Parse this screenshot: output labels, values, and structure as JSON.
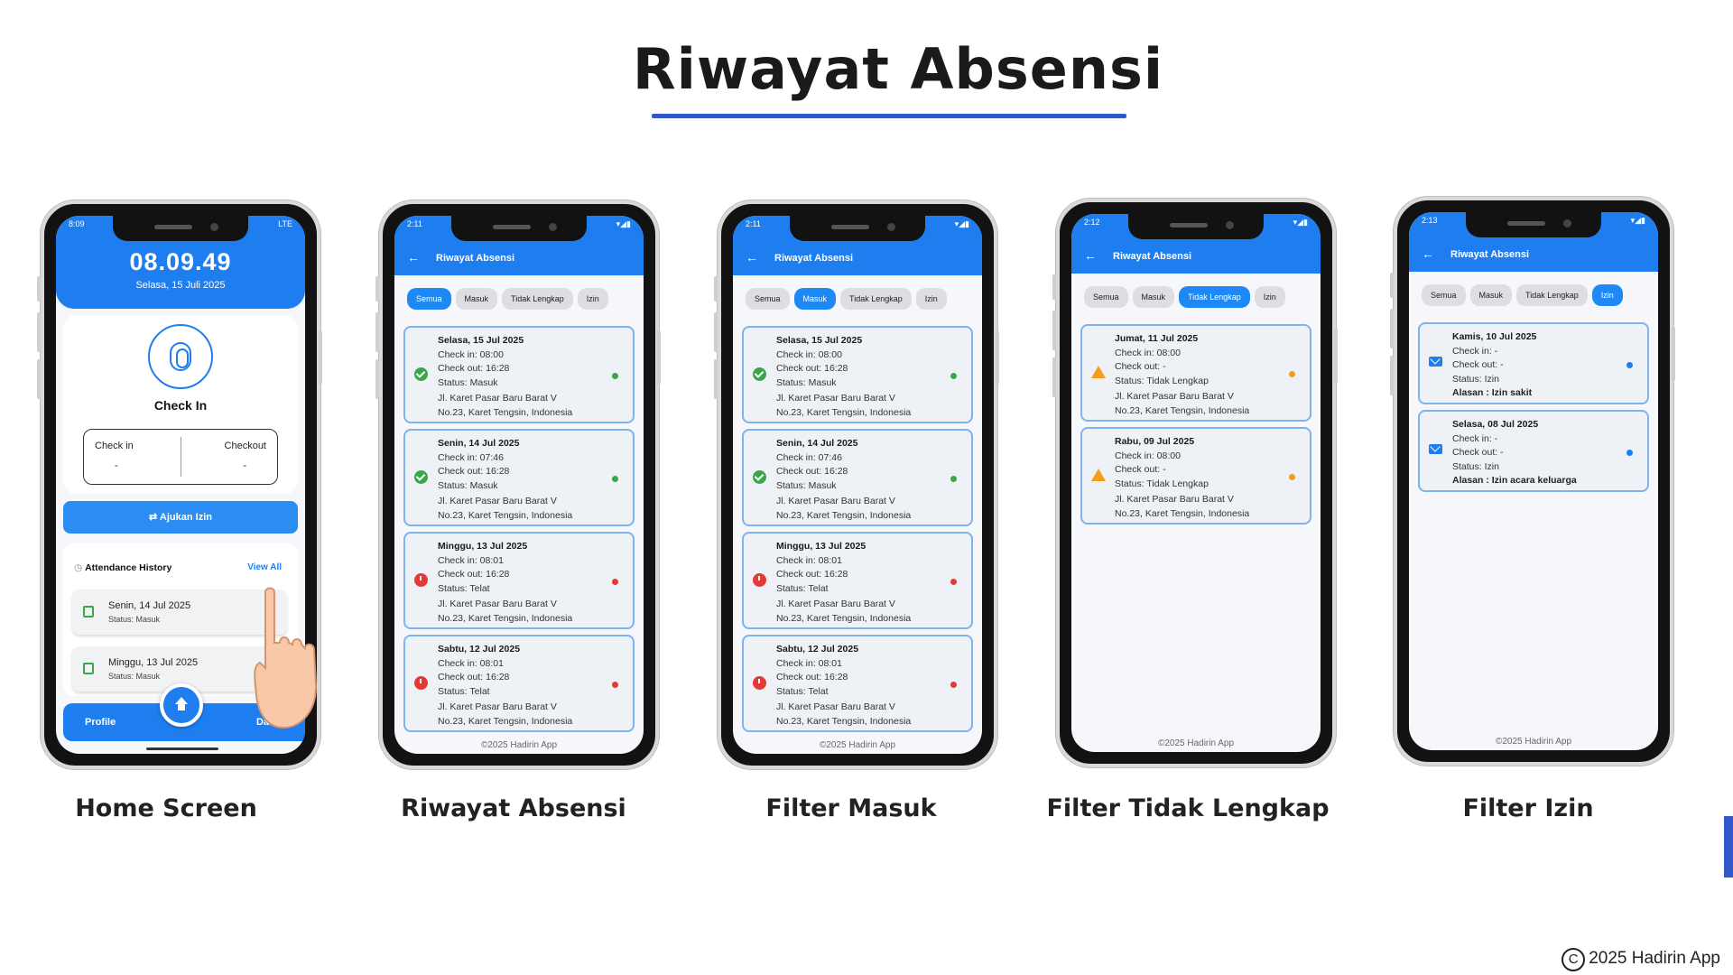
{
  "page_title": "Riwayat Absensi",
  "copyright": "2025 Hadirin App",
  "home": {
    "status_time": "8:09",
    "status_net": "LTE",
    "clock": "08.09.49",
    "date": "Selasa, 15 Juli 2025",
    "check_in_label": "Check In",
    "checkin_col": "Check in",
    "checkin_val": "-",
    "checkout_col": "Checkout",
    "checkout_val": "-",
    "izin_button": "Ajukan Izin",
    "history_title": "Attendance History",
    "view_all": "View All",
    "history": [
      {
        "date": "Senin, 14 Jul 2025",
        "status": "Status: Masuk"
      },
      {
        "date": "Minggu, 13 Jul 2025",
        "status": "Status: Masuk"
      }
    ],
    "nav_profile": "Profile",
    "nav_dashboard": "Dasboar",
    "caption": "Home Screen"
  },
  "screens": [
    {
      "caption": "Riwayat Absensi",
      "time": "2:11",
      "appbar_title": "Riwayat Absensi",
      "filters": [
        "Semua",
        "Masuk",
        "Tidak Lengkap",
        "Izin"
      ],
      "active_filter": 0,
      "footer": "©2025 Hadirin App",
      "cards": [
        {
          "date": "Selasa, 15 Jul 2025",
          "in": "Check in: 08:00",
          "out": "Check out: 16:28",
          "status": "Status: Masuk",
          "addr1": "Jl. Karet Pasar Baru Barat V",
          "addr2": "No.23, Karet Tengsin, Indonesia",
          "kind": "ok"
        },
        {
          "date": "Senin, 14 Jul 2025",
          "in": "Check in: 07:46",
          "out": "Check out: 16:28",
          "status": "Status: Masuk",
          "addr1": "Jl. Karet Pasar Baru Barat V",
          "addr2": "No.23, Karet Tengsin, Indonesia",
          "kind": "ok"
        },
        {
          "date": "Minggu, 13 Jul 2025",
          "in": "Check in: 08:01",
          "out": "Check out: 16:28",
          "status": "Status: Telat",
          "addr1": "Jl. Karet Pasar Baru Barat V",
          "addr2": "No.23, Karet Tengsin, Indonesia",
          "kind": "late"
        },
        {
          "date": "Sabtu, 12 Jul 2025",
          "in": "Check in: 08:01",
          "out": "Check out: 16:28",
          "status": "Status: Telat",
          "addr1": "Jl. Karet Pasar Baru Barat V",
          "addr2": "No.23, Karet Tengsin, Indonesia",
          "kind": "late"
        }
      ]
    },
    {
      "caption": "Filter Masuk",
      "time": "2:11",
      "appbar_title": "Riwayat Absensi",
      "filters": [
        "Semua",
        "Masuk",
        "Tidak Lengkap",
        "Izin"
      ],
      "active_filter": 1,
      "footer": "©2025 Hadirin App",
      "cards": [
        {
          "date": "Selasa, 15 Jul 2025",
          "in": "Check in: 08:00",
          "out": "Check out: 16:28",
          "status": "Status: Masuk",
          "addr1": "Jl. Karet Pasar Baru Barat V",
          "addr2": "No.23, Karet Tengsin, Indonesia",
          "kind": "ok"
        },
        {
          "date": "Senin, 14 Jul 2025",
          "in": "Check in: 07:46",
          "out": "Check out: 16:28",
          "status": "Status: Masuk",
          "addr1": "Jl. Karet Pasar Baru Barat V",
          "addr2": "No.23, Karet Tengsin, Indonesia",
          "kind": "ok"
        },
        {
          "date": "Minggu, 13 Jul 2025",
          "in": "Check in: 08:01",
          "out": "Check out: 16:28",
          "status": "Status: Telat",
          "addr1": "Jl. Karet Pasar Baru Barat V",
          "addr2": "No.23, Karet Tengsin, Indonesia",
          "kind": "late"
        },
        {
          "date": "Sabtu, 12 Jul 2025",
          "in": "Check in: 08:01",
          "out": "Check out: 16:28",
          "status": "Status: Telat",
          "addr1": "Jl. Karet Pasar Baru Barat V",
          "addr2": "No.23, Karet Tengsin, Indonesia",
          "kind": "late"
        }
      ]
    },
    {
      "caption": "Filter Tidak Lengkap",
      "time": "2:12",
      "appbar_title": "Riwayat Absensi",
      "filters": [
        "Semua",
        "Masuk",
        "Tidak Lengkap",
        "Izin"
      ],
      "active_filter": 2,
      "footer": "©2025 Hadirin App",
      "cards": [
        {
          "date": "Jumat, 11 Jul 2025",
          "in": "Check in: 08:00",
          "out": "Check out: -",
          "status": "Status: Tidak Lengkap",
          "addr1": "Jl. Karet Pasar Baru Barat V",
          "addr2": "No.23, Karet Tengsin, Indonesia",
          "kind": "warn"
        },
        {
          "date": "Rabu, 09 Jul 2025",
          "in": "Check in: 08:00",
          "out": "Check out: -",
          "status": "Status: Tidak Lengkap",
          "addr1": "Jl. Karet Pasar Baru Barat V",
          "addr2": "No.23, Karet Tengsin, Indonesia",
          "kind": "warn"
        }
      ]
    },
    {
      "caption": "Filter Izin",
      "time": "2:13",
      "appbar_title": "Riwayat Absensi",
      "filters": [
        "Semua",
        "Masuk",
        "Tidak Lengkap",
        "Izin"
      ],
      "active_filter": 3,
      "footer": "©2025 Hadirin App",
      "cards": [
        {
          "date": "Kamis, 10 Jul 2025",
          "in": "Check in: -",
          "out": "Check out: -",
          "status": "Status: Izin",
          "reason": "Alasan : Izin sakit",
          "kind": "mail"
        },
        {
          "date": "Selasa, 08 Jul 2025",
          "in": "Check in: -",
          "out": "Check out: -",
          "status": "Status: Izin",
          "reason": "Alasan : Izin acara keluarga",
          "kind": "mail"
        }
      ]
    }
  ]
}
